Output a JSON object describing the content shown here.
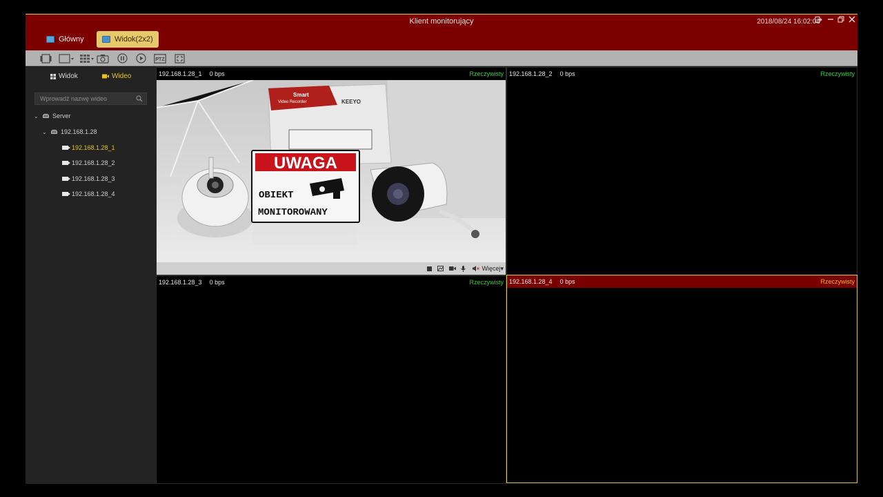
{
  "window": {
    "title": "Klient monitorujący",
    "datetime": "2018/08/24 16:02:08"
  },
  "tabs": [
    {
      "label": "Główny",
      "icon": "monitor-icon"
    },
    {
      "label": "Widok(2x2)",
      "icon": "view-layout-icon",
      "active": true
    }
  ],
  "toolbar": {
    "buttons": [
      "sequence-icon",
      "layout-single-icon",
      "layout-grid-icon",
      "snapshot-icon",
      "pause-icon",
      "play-icon",
      "ptz-icon",
      "fullscreen-icon"
    ],
    "ptz_label": "PTZ"
  },
  "sidebar": {
    "tab_view": "Widok",
    "tab_video": "Wideo",
    "search_placeholder": "Wprowadź nazwę wideo",
    "tree": [
      {
        "label": "Server",
        "level": 0,
        "type": "server"
      },
      {
        "label": "192.168.1.28",
        "level": 1,
        "type": "device"
      },
      {
        "label": "192.168.1.28_1",
        "level": 2,
        "type": "camera",
        "selected": true
      },
      {
        "label": "192.168.1.28_2",
        "level": 2,
        "type": "camera"
      },
      {
        "label": "192.168.1.28_3",
        "level": 2,
        "type": "camera"
      },
      {
        "label": "192.168.1.28_4",
        "level": 2,
        "type": "camera"
      }
    ]
  },
  "panes": [
    {
      "name": "192.168.1.28_1",
      "rate": "0 bps",
      "mode": "Rzeczywisty",
      "has_video": true
    },
    {
      "name": "192.168.1.28_2",
      "rate": "0 bps",
      "mode": "Rzeczywisty"
    },
    {
      "name": "192.168.1.28_3",
      "rate": "0 bps",
      "mode": "Rzeczywisty"
    },
    {
      "name": "192.168.1.28_4",
      "rate": "0 bps",
      "mode": "Rzeczywisty",
      "selected": true
    }
  ],
  "video": {
    "box_brand_line1": "Smart",
    "box_brand_line2": "Video Recorder",
    "box_logo": "KEEYO",
    "sign_title": "UWAGA",
    "sign_line1": "OBIEKT",
    "sign_line2": "MONITOROWANY",
    "more_label": "Więcej"
  },
  "colors": {
    "titlebar": "#7c0000",
    "accent": "#e5c420",
    "live": "#2fcf3e"
  }
}
